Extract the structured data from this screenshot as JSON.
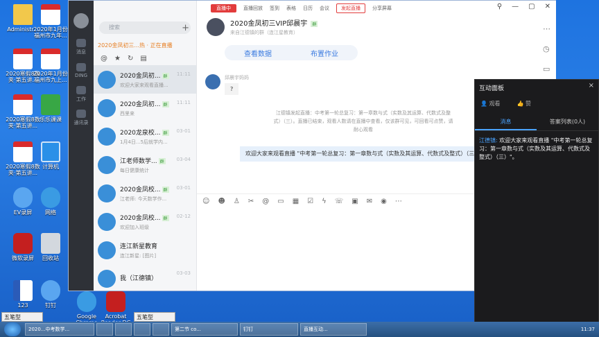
{
  "desktop": {
    "icons": [
      {
        "label": "Administr...",
        "kind": "folder"
      },
      {
        "label": "2020年1月份福州市九年...",
        "kind": "pdf"
      },
      {
        "label": "2020寒假8数夹·第五讲...",
        "kind": "pdf"
      },
      {
        "label": "2020年1月份福州市九上...",
        "kind": "pdf"
      },
      {
        "label": "2020寒假8数夹·第五讲...",
        "kind": "pdf"
      },
      {
        "label": "乐乐课课",
        "kind": "green"
      },
      {
        "label": "2020寒假8数夹·第五讲...",
        "kind": "pdf"
      },
      {
        "label": "计算机",
        "kind": "pc"
      },
      {
        "label": "EV录屏",
        "kind": "blue"
      },
      {
        "label": "网络",
        "kind": "globe"
      },
      {
        "label": "微软录屏",
        "kind": "red"
      },
      {
        "label": "回收站",
        "kind": "gray"
      },
      {
        "label": "123",
        "kind": "word"
      },
      {
        "label": "钉钉",
        "kind": "blue"
      },
      {
        "label": "Google Chrome",
        "kind": "globe"
      },
      {
        "label": "Acrobat Reader DC",
        "kind": "red"
      }
    ]
  },
  "app": {
    "leftbar": {
      "items": [
        {
          "label": "消息"
        },
        {
          "label": "DING"
        },
        {
          "label": "工作"
        },
        {
          "label": "通讯录"
        }
      ]
    },
    "conversations": {
      "search_placeholder": "搜索",
      "plus": "+",
      "notice": "2020金凤初三...热 · 正在直播",
      "items": [
        {
          "name": "2020金凤初...",
          "tag": "群",
          "sub": "欢迎大家来观看直播...",
          "time": "11:11",
          "active": true
        },
        {
          "name": "2020金凤初...",
          "tag": "群",
          "sub": "西里来",
          "time": "11:11",
          "active": false
        },
        {
          "name": "2020龙泉校...",
          "tag": "群",
          "sub": "1月4日...5后就学内...",
          "time": "03-01",
          "active": false
        },
        {
          "name": "江老师数学...",
          "tag": "群",
          "sub": "每日健康统计",
          "time": "03-04",
          "active": false
        },
        {
          "name": "2020金凤校...",
          "tag": "群",
          "sub": "江老师: 今天数学作...",
          "time": "03-01",
          "active": false
        },
        {
          "name": "2020金凤校...",
          "tag": "群",
          "sub": "欢迎加入班级",
          "time": "02-12",
          "active": false
        },
        {
          "name": "连江新星教育",
          "tag": "",
          "sub": "连江新星: [图片]",
          "time": "",
          "active": false
        },
        {
          "name": "我（江德镇）",
          "tag": "",
          "sub": "",
          "time": "03-03",
          "active": false
        }
      ]
    },
    "chat": {
      "toolbar": {
        "live": "直播中",
        "items": [
          "直播回放",
          "签到",
          "表格",
          "日历",
          "会议",
          "发起直播",
          "分享屏幕"
        ]
      },
      "group_title": "2020金凤初三VIP邱晨宇",
      "group_tag": "群",
      "group_sub": "来自江德镇的群（连江星教育）",
      "tabs": [
        "查看数据",
        "布置作业"
      ],
      "msg1_name": "邱晨宇妈妈",
      "msg1_text": "?",
      "notice": "江德镇发起直播：中考第一轮总复习：第一章数与式（实数及其运算、代数式及整式）（三）。直播已结束，观看人数请在直播中查看，仅该群可见，可回看可点赞，请耐心观看",
      "self_msg": "欢迎大家来观看直播 \"中考第一轮总复习：第一章数与式（实数及其运算、代数式及整式）（三）\"。"
    }
  },
  "panel": {
    "title": "互动面板",
    "close": "×",
    "views_label": "观看",
    "likes_label": "赞",
    "tabs": [
      "消息",
      "答案列表(0人)"
    ],
    "msg_who": "江德镇:",
    "msg_text": "欢迎大家来观看直播 \"中考第一轮总复习：第一章数与式（实数及其运算、代数式及整式）（三）\"。"
  },
  "ime": {
    "label": "五笔型"
  },
  "taskbar": {
    "buttons": [
      "2020...中考数学...",
      "",
      "",
      "",
      "",
      "第二节 co...",
      "钉钉",
      "直播互动..."
    ],
    "clock": "11:37"
  }
}
